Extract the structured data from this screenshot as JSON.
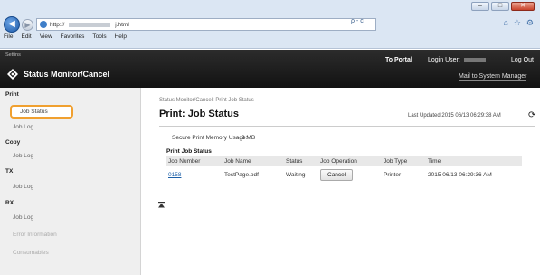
{
  "browser": {
    "address_prefix": "http://",
    "address_suffix": "j.html",
    "search_glyph": "ρ - c",
    "menu": [
      "File",
      "Edit",
      "View",
      "Favorites",
      "Tools",
      "Help"
    ]
  },
  "header": {
    "small_text": "Settins",
    "title": "Status Monitor/Cancel",
    "to_portal": "To Portal",
    "login_user_label": "Login User:",
    "log_out": "Log Out",
    "mail_to_manager": "Mail to System Manager"
  },
  "sidebar": {
    "sections": [
      {
        "title": "Print",
        "items": [
          "Job Status",
          "Job Log"
        ]
      },
      {
        "title": "Copy",
        "items": [
          "Job Log"
        ]
      },
      {
        "title": "TX",
        "items": [
          "Job Log"
        ]
      },
      {
        "title": "RX",
        "items": [
          "Job Log",
          "Error Information",
          "Consumables"
        ]
      }
    ]
  },
  "main": {
    "breadcrumb": "Status Monitor/Cancel: Print Job Status",
    "title": "Print: Job Status",
    "last_updated": "Last Updated:2015 06/13 06:29:38 AM",
    "secure_memory_label": "Secure Print Memory Usage:",
    "secure_memory_value": "0 MB",
    "section_title": "Print Job Status",
    "columns": [
      "Job Number",
      "Job Name",
      "Status",
      "Job Operation",
      "Job Type",
      "Time"
    ],
    "row": {
      "job_number": "0158",
      "job_name": "TestPage.pdf",
      "status": "Waiting",
      "operation": "Cancel",
      "job_type": "Printer",
      "time": "2015 06/13 06:29:36 AM"
    }
  },
  "icons": {
    "back": "back-arrow-icon",
    "forward": "forward-arrow-icon",
    "refresh": "refresh-icon",
    "top": "top-of-page-icon",
    "logo": "printer-logo-icon"
  }
}
